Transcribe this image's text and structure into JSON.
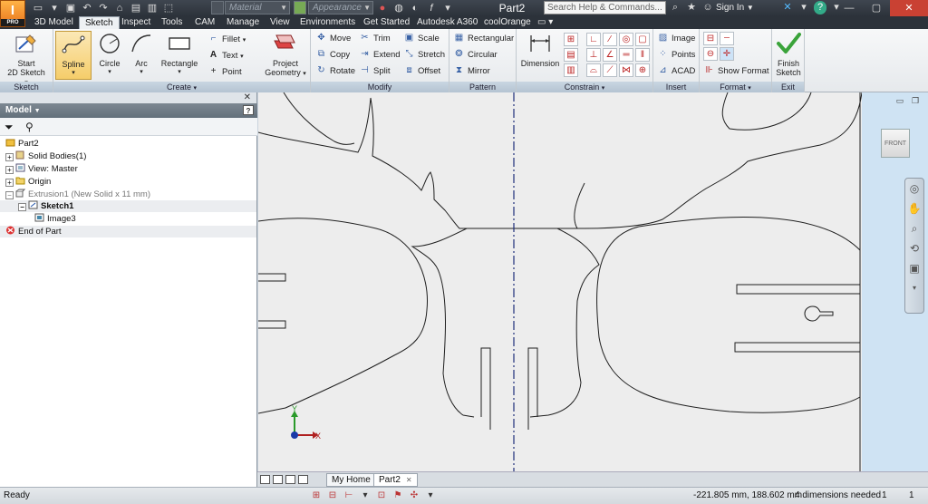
{
  "app": {
    "logo": "I",
    "edition": "PRO"
  },
  "qat": {
    "icons": [
      "file-icon",
      "new-icon",
      "save-icon",
      "undo-icon",
      "redo-icon",
      "home-icon",
      "open-icon",
      "print-icon",
      "select-icon"
    ]
  },
  "material_combo": {
    "value": "Material"
  },
  "appearance_combo": {
    "value": "Appearance"
  },
  "document_title": "Part2",
  "search": {
    "placeholder": "Search Help & Commands..."
  },
  "signin": "Sign In",
  "menu_tabs": [
    "3D Model",
    "Sketch",
    "Inspect",
    "Tools",
    "CAM",
    "Manage",
    "View",
    "Environments",
    "Get Started",
    "Autodesk A360",
    "coolOrange"
  ],
  "active_tab": "Sketch",
  "ribbon": {
    "sketch_panel": {
      "label": "Sketch",
      "start": "Start",
      "start2": "2D Sketch"
    },
    "create_panel": {
      "label": "Create",
      "spline": "Spline",
      "circle": "Circle",
      "arc": "Arc",
      "rectangle": "Rectangle",
      "fillet": "Fillet",
      "text": "Text",
      "point": "Point",
      "project1": "Project",
      "project2": "Geometry"
    },
    "modify_panel": {
      "label": "Modify",
      "move": "Move",
      "trim": "Trim",
      "scale": "Scale",
      "copy": "Copy",
      "extend": "Extend",
      "stretch": "Stretch",
      "rotate": "Rotate",
      "split": "Split",
      "offset": "Offset"
    },
    "pattern_panel": {
      "label": "Pattern",
      "rectangular": "Rectangular",
      "circular": "Circular",
      "mirror": "Mirror"
    },
    "constrain_panel": {
      "label": "Constrain",
      "dimension": "Dimension"
    },
    "insert_panel": {
      "label": "Insert",
      "image": "Image",
      "points": "Points",
      "acad": "ACAD"
    },
    "format_panel": {
      "label": "Format",
      "show_format": "Show Format"
    },
    "exit_panel": {
      "label": "Exit",
      "finish1": "Finish",
      "finish2": "Sketch"
    }
  },
  "browser": {
    "title": "Model",
    "nodes": {
      "part": "Part2",
      "solid_bodies": "Solid Bodies(1)",
      "view": "View: Master",
      "origin": "Origin",
      "extrusion": "Extrusion1 (New Solid x 11 mm)",
      "sketch": "Sketch1",
      "image": "Image3",
      "end": "End of Part"
    }
  },
  "viewcube": {
    "face": "FRONT"
  },
  "axes": {
    "x": "X",
    "y": "Y"
  },
  "doc_tabs": {
    "home": "My Home",
    "part": "Part2"
  },
  "status": {
    "left": "Ready",
    "coords": "-221.805 mm, 188.602 mm",
    "dims": "4 dimensions needed",
    "n1": "1",
    "n2": "1"
  },
  "colors": {
    "accent": "#e8731c",
    "ribbon_label": "#b4c3d1",
    "canvas": "#ededed",
    "viewcube_bg": "#cfe3f3",
    "centerline": "#1f2f7a"
  }
}
